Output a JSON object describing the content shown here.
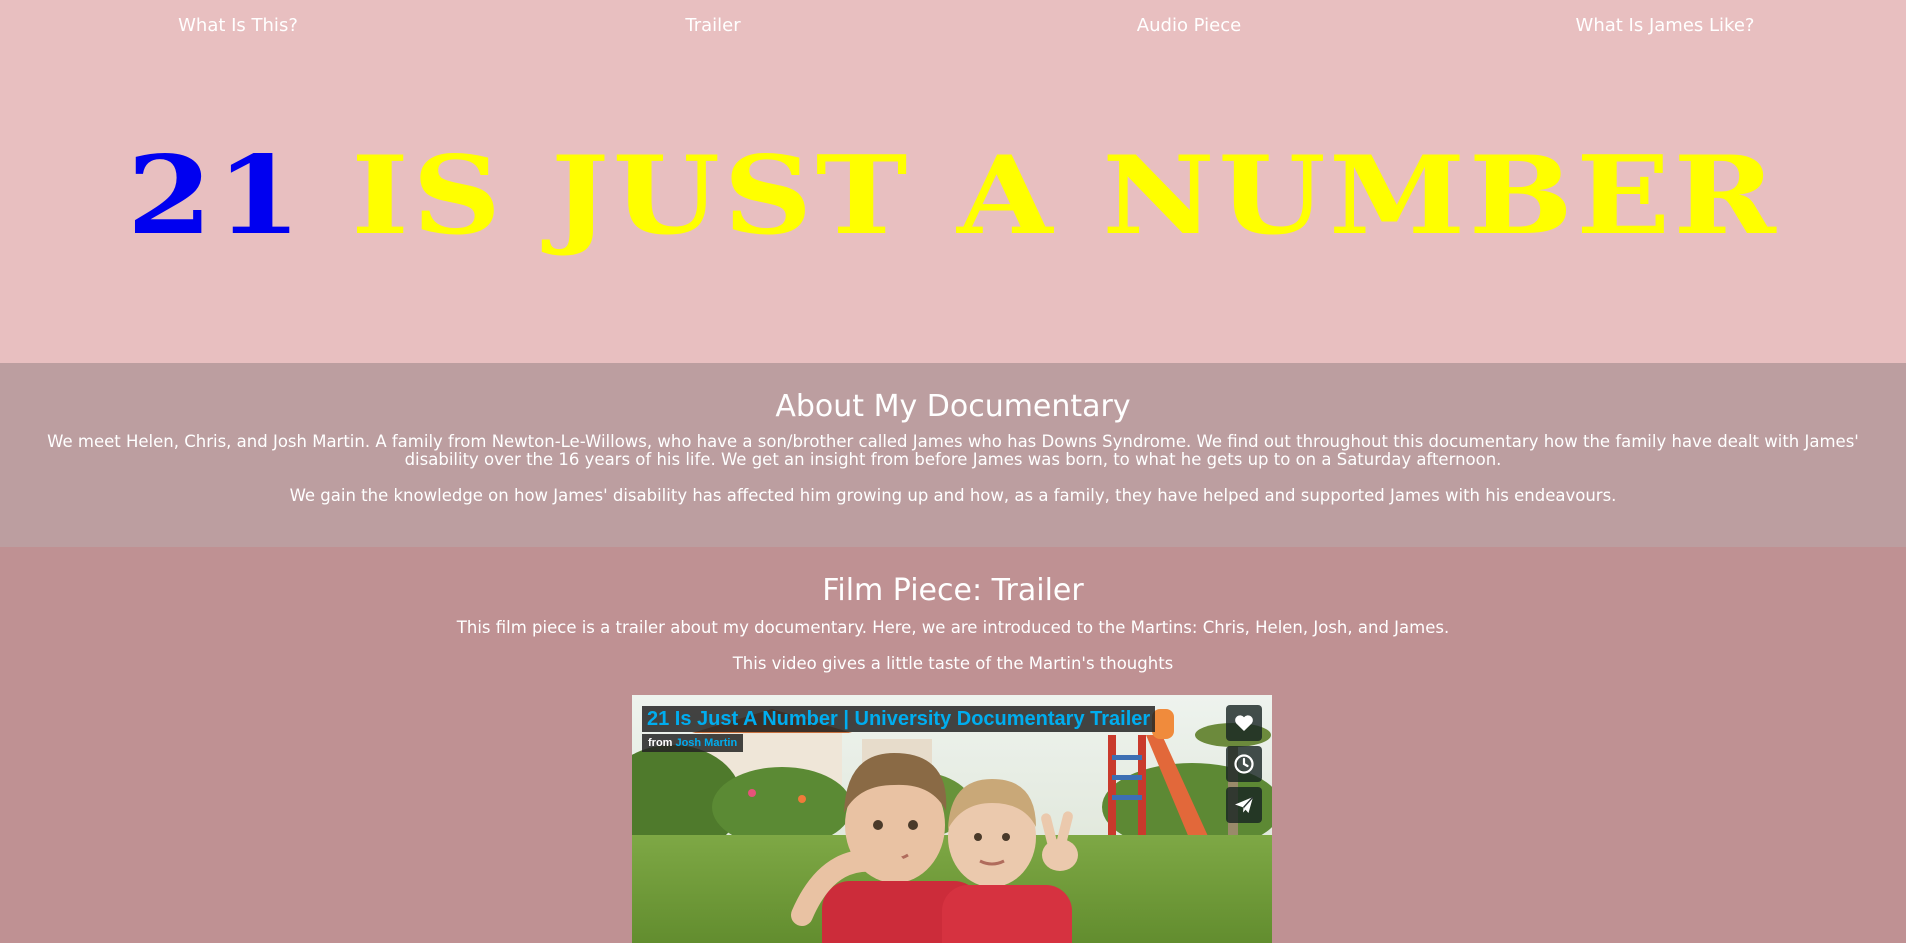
{
  "nav": {
    "items": [
      {
        "label": "What Is This?"
      },
      {
        "label": "Trailer"
      },
      {
        "label": "Audio Piece"
      },
      {
        "label": "What Is James Like?"
      }
    ]
  },
  "hero": {
    "title_number": "21",
    "title_rest": "IS JUST A NUMBER",
    "number_color": "#0000f0",
    "rest_color": "#ffff00"
  },
  "about": {
    "heading": "About My Documentary",
    "paragraph1": "We meet Helen, Chris, and Josh Martin. A family from Newton-Le-Willows, who have a son/brother called James who has Downs Syndrome. We find out throughout this documentary how the family have dealt with James' disability over the 16 years of his life. We get an insight from before James was born, to what he gets up to on a Saturday afternoon.",
    "paragraph2": "We gain the knowledge on how James' disability has affected him growing up and how, as a family, they have helped and supported James with his endeavours."
  },
  "trailer": {
    "heading": "Film Piece: Trailer",
    "paragraph1": "This film piece is a trailer about my documentary. Here, we are introduced to the Martins: Chris, Helen, Josh, and James.",
    "paragraph2": "This video gives a little taste of the Martin's thoughts",
    "video": {
      "title": "21 Is Just A Number | University Documentary Trailer",
      "from_label": "from",
      "author": "Josh Martin",
      "buttons": [
        {
          "icon": "heart-icon"
        },
        {
          "icon": "clock-icon"
        },
        {
          "icon": "paper-plane-icon"
        }
      ]
    }
  },
  "colors": {
    "page_bg": "#e8bfc0",
    "about_bg": "#bc9ea0",
    "trailer_bg": "#bf9193",
    "video_link": "#00adef"
  }
}
